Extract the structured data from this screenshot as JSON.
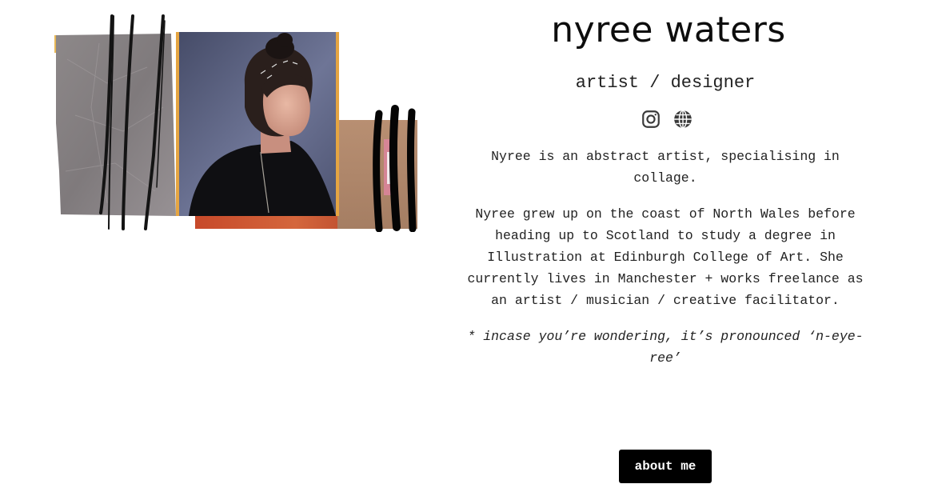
{
  "profile": {
    "name": "nyree waters",
    "role": "artist / designer"
  },
  "social": [
    {
      "icon": "instagram-icon"
    },
    {
      "icon": "globe-icon"
    }
  ],
  "bio": {
    "p1": "Nyree is an abstract artist, specialising in collage.",
    "p2": "Nyree grew up on the coast of North Wales before heading up to Scotland to study a degree in Illustration at Edinburgh College of Art. She currently lives in Manchester + works freelance as an artist / musician / creative facilitator.",
    "p3": "* incase you’re wondering, it’s pronounced ‘n-eye-ree’"
  },
  "cta": {
    "about_label": "about me"
  },
  "colors": {
    "background": "#ffffff",
    "text": "#222222",
    "button_bg": "#000000",
    "button_text": "#ffffff"
  }
}
